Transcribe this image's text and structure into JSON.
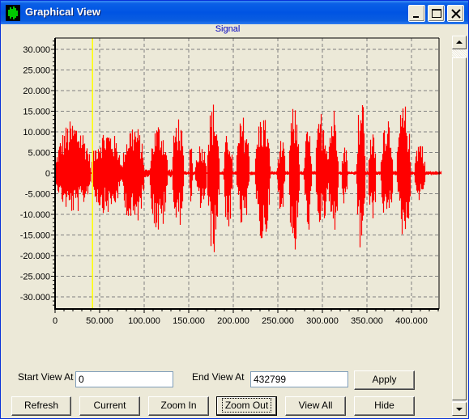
{
  "window": {
    "title": "Graphical View",
    "icon": "waveform-app-icon",
    "controls": {
      "minimize": "minimize-icon",
      "maximize": "maximize-icon",
      "close": "close-icon"
    }
  },
  "chart_data": {
    "type": "line",
    "title": "Signal",
    "xlabel": "",
    "ylabel": "",
    "xlim": [
      0,
      432799
    ],
    "ylim": [
      -32768,
      32767
    ],
    "x_ticks": [
      0,
      50000,
      100000,
      150000,
      200000,
      250000,
      300000,
      350000,
      400000
    ],
    "x_tick_labels": [
      "0",
      "50.000",
      "100.000",
      "150.000",
      "200.000",
      "250.000",
      "300.000",
      "350.000",
      "400.000"
    ],
    "y_ticks": [
      30000,
      25000,
      20000,
      15000,
      10000,
      5000,
      0,
      -5000,
      -10000,
      -15000,
      -20000,
      -25000,
      -30000
    ],
    "y_tick_labels": [
      "30.000",
      "25.000",
      "20.000",
      "15.000",
      "10.000",
      "5.000",
      "0",
      "-5.000",
      "-10.000",
      "-15.000",
      "-20.000",
      "-25.000",
      "-30.000"
    ],
    "grid": true,
    "series_color": "#ff0000",
    "cursor": {
      "x": 42000,
      "color": "#ffff00"
    },
    "series": [
      {
        "name": "Signal",
        "envelope_segments": [
          {
            "x_start": 0,
            "x_end": 40000,
            "pos_peak": 13000,
            "neg_peak": -10000
          },
          {
            "x_start": 40000,
            "x_end": 75000,
            "pos_peak": 11000,
            "neg_peak": -10000
          },
          {
            "x_start": 75000,
            "x_end": 100000,
            "pos_peak": 12500,
            "neg_peak": -13500
          },
          {
            "x_start": 100000,
            "x_end": 106000,
            "pos_peak": 1000,
            "neg_peak": -1000
          },
          {
            "x_start": 106000,
            "x_end": 126000,
            "pos_peak": 12500,
            "neg_peak": -15500
          },
          {
            "x_start": 126000,
            "x_end": 131000,
            "pos_peak": 1000,
            "neg_peak": -1000
          },
          {
            "x_start": 131000,
            "x_end": 144000,
            "pos_peak": 14500,
            "neg_peak": -14000
          },
          {
            "x_start": 144000,
            "x_end": 150000,
            "pos_peak": 500,
            "neg_peak": -500
          },
          {
            "x_start": 150000,
            "x_end": 154000,
            "pos_peak": 7500,
            "neg_peak": -7000
          },
          {
            "x_start": 154000,
            "x_end": 157000,
            "pos_peak": 500,
            "neg_peak": -500
          },
          {
            "x_start": 157000,
            "x_end": 170000,
            "pos_peak": 7500,
            "neg_peak": -9000
          },
          {
            "x_start": 170000,
            "x_end": 184000,
            "pos_peak": 17500,
            "neg_peak": -20000
          },
          {
            "x_start": 184000,
            "x_end": 189000,
            "pos_peak": 500,
            "neg_peak": -500
          },
          {
            "x_start": 189000,
            "x_end": 199000,
            "pos_peak": 10500,
            "neg_peak": -14500
          },
          {
            "x_start": 199000,
            "x_end": 203000,
            "pos_peak": 500,
            "neg_peak": -500
          },
          {
            "x_start": 203000,
            "x_end": 218000,
            "pos_peak": 14000,
            "neg_peak": -14500
          },
          {
            "x_start": 218000,
            "x_end": 224000,
            "pos_peak": 500,
            "neg_peak": -500
          },
          {
            "x_start": 224000,
            "x_end": 241000,
            "pos_peak": 15000,
            "neg_peak": -18000
          },
          {
            "x_start": 241000,
            "x_end": 249000,
            "pos_peak": 500,
            "neg_peak": -500
          },
          {
            "x_start": 249000,
            "x_end": 258000,
            "pos_peak": 8500,
            "neg_peak": -9500
          },
          {
            "x_start": 258000,
            "x_end": 262000,
            "pos_peak": 500,
            "neg_peak": -500
          },
          {
            "x_start": 262000,
            "x_end": 274000,
            "pos_peak": 16500,
            "neg_peak": -20000
          },
          {
            "x_start": 274000,
            "x_end": 279000,
            "pos_peak": 500,
            "neg_peak": -500
          },
          {
            "x_start": 279000,
            "x_end": 288000,
            "pos_peak": 11000,
            "neg_peak": -14500
          },
          {
            "x_start": 288000,
            "x_end": 292000,
            "pos_peak": 500,
            "neg_peak": -500
          },
          {
            "x_start": 292000,
            "x_end": 306000,
            "pos_peak": 15500,
            "neg_peak": -14000
          },
          {
            "x_start": 306000,
            "x_end": 318000,
            "pos_peak": 16500,
            "neg_peak": -15000
          },
          {
            "x_start": 318000,
            "x_end": 321000,
            "pos_peak": 500,
            "neg_peak": -500
          },
          {
            "x_start": 321000,
            "x_end": 328000,
            "pos_peak": 7500,
            "neg_peak": -8500
          },
          {
            "x_start": 328000,
            "x_end": 338000,
            "pos_peak": 500,
            "neg_peak": -500
          },
          {
            "x_start": 338000,
            "x_end": 348000,
            "pos_peak": 19500,
            "neg_peak": -20000
          },
          {
            "x_start": 348000,
            "x_end": 351000,
            "pos_peak": 500,
            "neg_peak": -500
          },
          {
            "x_start": 351000,
            "x_end": 360000,
            "pos_peak": 10000,
            "neg_peak": -13000
          },
          {
            "x_start": 360000,
            "x_end": 365000,
            "pos_peak": 500,
            "neg_peak": -500
          },
          {
            "x_start": 365000,
            "x_end": 379000,
            "pos_peak": 15500,
            "neg_peak": -12500
          },
          {
            "x_start": 379000,
            "x_end": 383000,
            "pos_peak": 500,
            "neg_peak": -500
          },
          {
            "x_start": 383000,
            "x_end": 399000,
            "pos_peak": 17000,
            "neg_peak": -16000
          },
          {
            "x_start": 399000,
            "x_end": 403000,
            "pos_peak": 500,
            "neg_peak": -500
          },
          {
            "x_start": 403000,
            "x_end": 415000,
            "pos_peak": 8500,
            "neg_peak": -7000
          },
          {
            "x_start": 415000,
            "x_end": 432799,
            "pos_peak": 500,
            "neg_peak": -500
          }
        ]
      }
    ]
  },
  "controls": {
    "start_label": "Start View At",
    "start_value": "0",
    "end_label": "End View At",
    "end_value": "432799",
    "apply": "Apply",
    "refresh": "Refresh",
    "current": "Current",
    "zoom_in": "Zoom In",
    "zoom_out": "Zoom Out",
    "view_all": "View All",
    "hide": "Hide"
  }
}
